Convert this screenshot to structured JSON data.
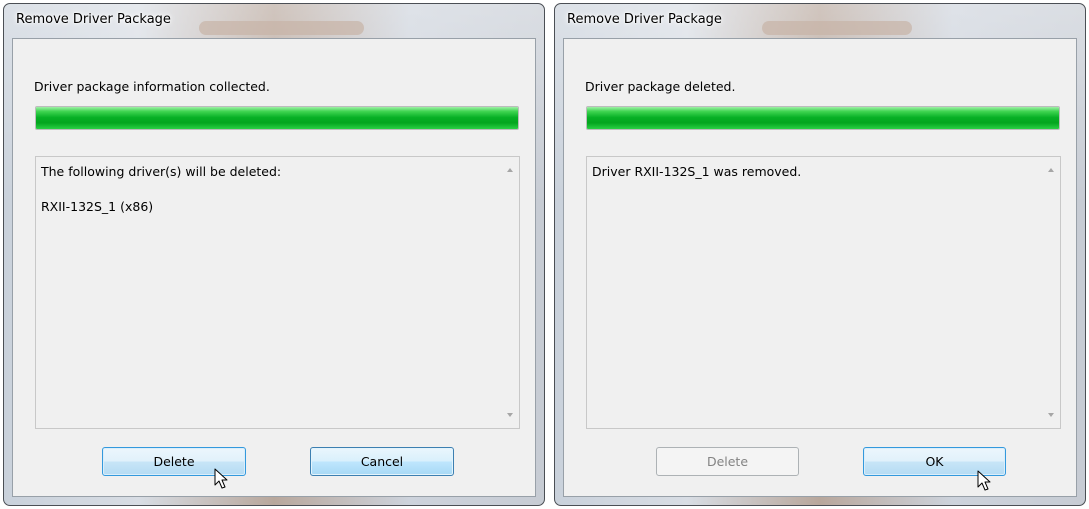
{
  "dialog1": {
    "title": "Remove Driver Package",
    "status": "Driver package information collected.",
    "progress_fraction": 1.0,
    "list_lines": [
      "The following driver(s) will be deleted:",
      "RXII-132S_1 (x86)"
    ],
    "buttons": {
      "delete_label": "Delete",
      "cancel_label": "Cancel"
    }
  },
  "dialog2": {
    "title": "Remove Driver Package",
    "status": "Driver package deleted.",
    "progress_fraction": 1.0,
    "list_lines": [
      "Driver RXII-132S_1 was removed."
    ],
    "buttons": {
      "delete_label": "Delete",
      "ok_label": "OK"
    }
  },
  "colors": {
    "progress_green": "#06b025",
    "default_button_border": "#3c7fb1",
    "client_background": "#f0f0f0"
  },
  "icons": {
    "cursor": "arrow-pointer-icon",
    "scroll_up": "scroll-up-arrow-icon",
    "scroll_down": "scroll-down-arrow-icon"
  }
}
